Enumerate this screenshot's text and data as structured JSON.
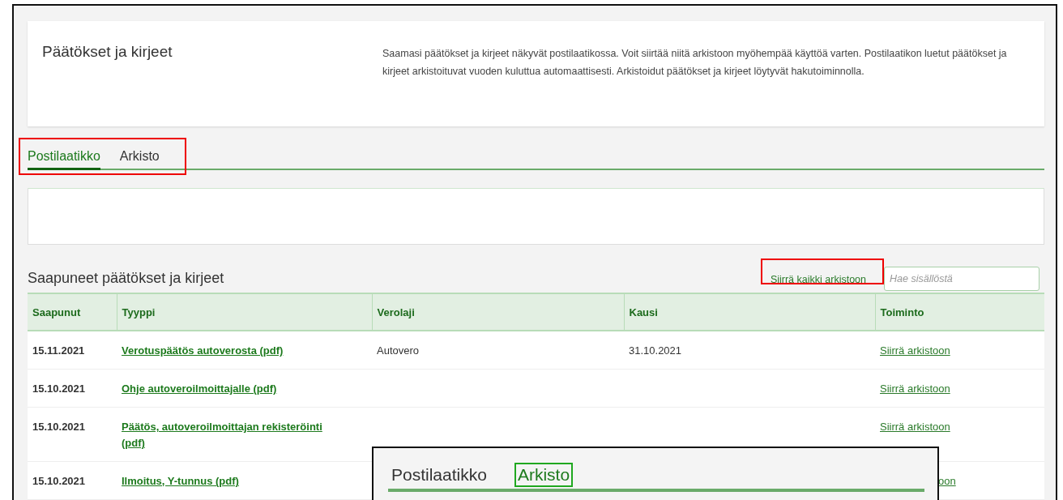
{
  "header": {
    "title": "Päätökset ja kirjeet",
    "description": "Saamasi päätökset ja kirjeet näkyvät postilaatikossa. Voit siirtää niitä arkistoon myöhempää käyttöä varten. Postilaatikon luetut päätökset ja kirjeet arkistoituvat vuoden kuluttua automaattisesti. Arkistoidut päätökset ja kirjeet löytyvät hakutoiminnolla."
  },
  "tabs": [
    {
      "label": "Postilaatikko",
      "selected": true
    },
    {
      "label": "Arkisto",
      "selected": false
    }
  ],
  "section": {
    "title": "Saapuneet päätökset ja kirjeet",
    "archive_all_link": "Siirrä kaikki arkistoon",
    "search": {
      "placeholder": "Hae sisällöstä"
    }
  },
  "table": {
    "columns": [
      "Saapunut",
      "Tyyppi",
      "Verolaji",
      "Kausi",
      "Toiminto"
    ],
    "rows": [
      {
        "saapunut": "15.11.2021",
        "tyyppi": "Verotuspäätös autoverosta (pdf)",
        "verolaji": "Autovero",
        "kausi": "31.10.2021",
        "toiminto": "Siirrä arkistoon"
      },
      {
        "saapunut": "15.10.2021",
        "tyyppi": "Ohje autoveroilmoittajalle (pdf)",
        "toiminto": "Siirrä arkistoon"
      },
      {
        "saapunut": "15.10.2021",
        "tyyppi": "Päätös, autoveroilmoittajan rekisteröinti (pdf)",
        "toiminto": "Siirrä arkistoon"
      },
      {
        "saapunut": "15.10.2021",
        "tyyppi": "Ilmoitus, Y-tunnus (pdf)",
        "toiminto": "oon",
        "covered": true
      }
    ]
  },
  "inset": {
    "tabs": [
      {
        "label": "Postilaatikko",
        "highlighted": false
      },
      {
        "label": "Arkisto",
        "highlighted": true
      }
    ]
  }
}
